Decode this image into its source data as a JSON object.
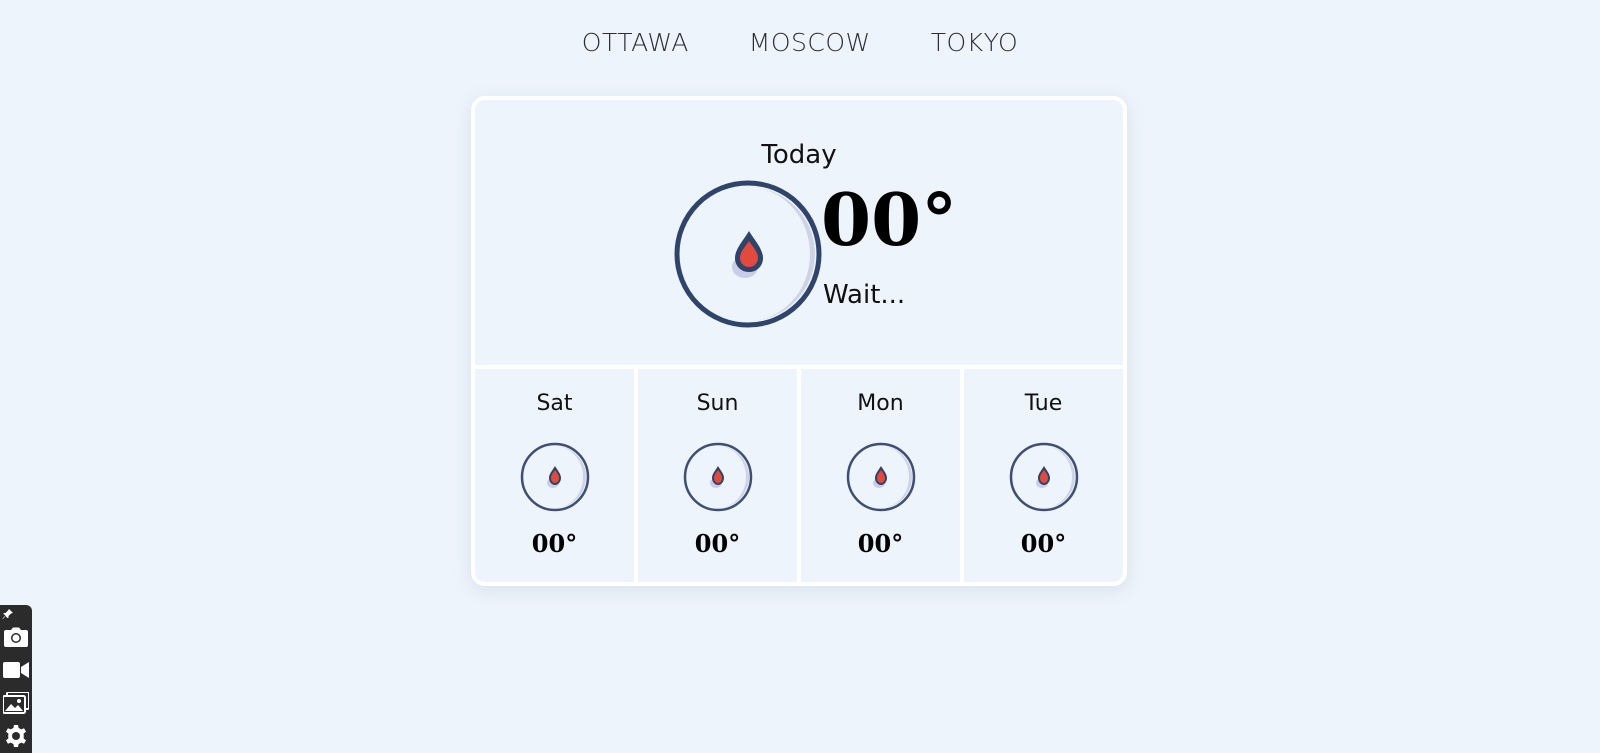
{
  "nav": {
    "cities": [
      "OTTAWA",
      "MOSCOW",
      "TOKYO"
    ]
  },
  "today": {
    "label": "Today",
    "temp": "00°",
    "status": "Wait...",
    "icon": "droplet-icon"
  },
  "forecast": [
    {
      "day": "Sat",
      "temp": "00°",
      "icon": "droplet-icon"
    },
    {
      "day": "Sun",
      "temp": "00°",
      "icon": "droplet-icon"
    },
    {
      "day": "Mon",
      "temp": "00°",
      "icon": "droplet-icon"
    },
    {
      "day": "Tue",
      "temp": "00°",
      "icon": "droplet-icon"
    }
  ],
  "toolbar": {
    "items": [
      "pin-icon",
      "camera-icon",
      "video-icon",
      "gallery-icon",
      "settings-icon"
    ]
  },
  "colors": {
    "background": "#eef4fb",
    "ring": "#2f446a",
    "shadow": "#cfd3e8",
    "drop": "#e04a3f"
  }
}
